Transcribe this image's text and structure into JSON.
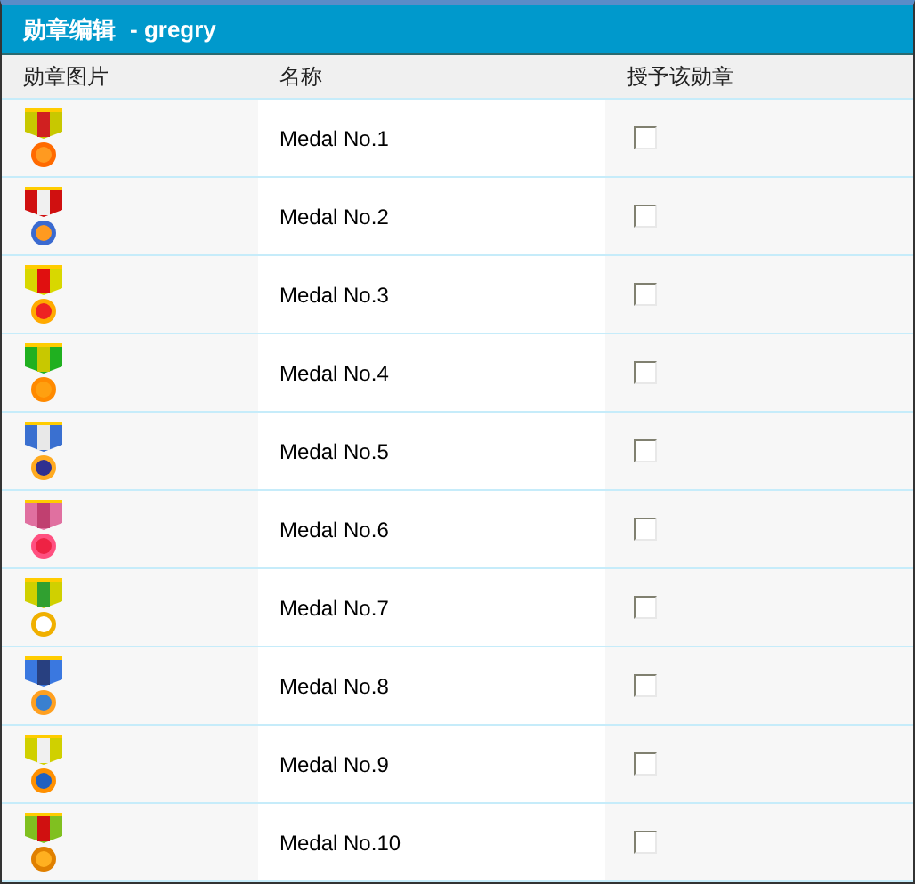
{
  "window": {
    "title": "勋章编辑",
    "user": "- gregry"
  },
  "table": {
    "columns": [
      "勋章图片",
      "名称",
      "授予该勋章"
    ],
    "rows": [
      {
        "name": "Medal No.1",
        "checked": false
      },
      {
        "name": "Medal No.2",
        "checked": false
      },
      {
        "name": "Medal No.3",
        "checked": false
      },
      {
        "name": "Medal No.4",
        "checked": false
      },
      {
        "name": "Medal No.5",
        "checked": false
      },
      {
        "name": "Medal No.6",
        "checked": false
      },
      {
        "name": "Medal No.7",
        "checked": false
      },
      {
        "name": "Medal No.8",
        "checked": false
      },
      {
        "name": "Medal No.9",
        "checked": false
      },
      {
        "name": "Medal No.10",
        "checked": false
      }
    ]
  }
}
